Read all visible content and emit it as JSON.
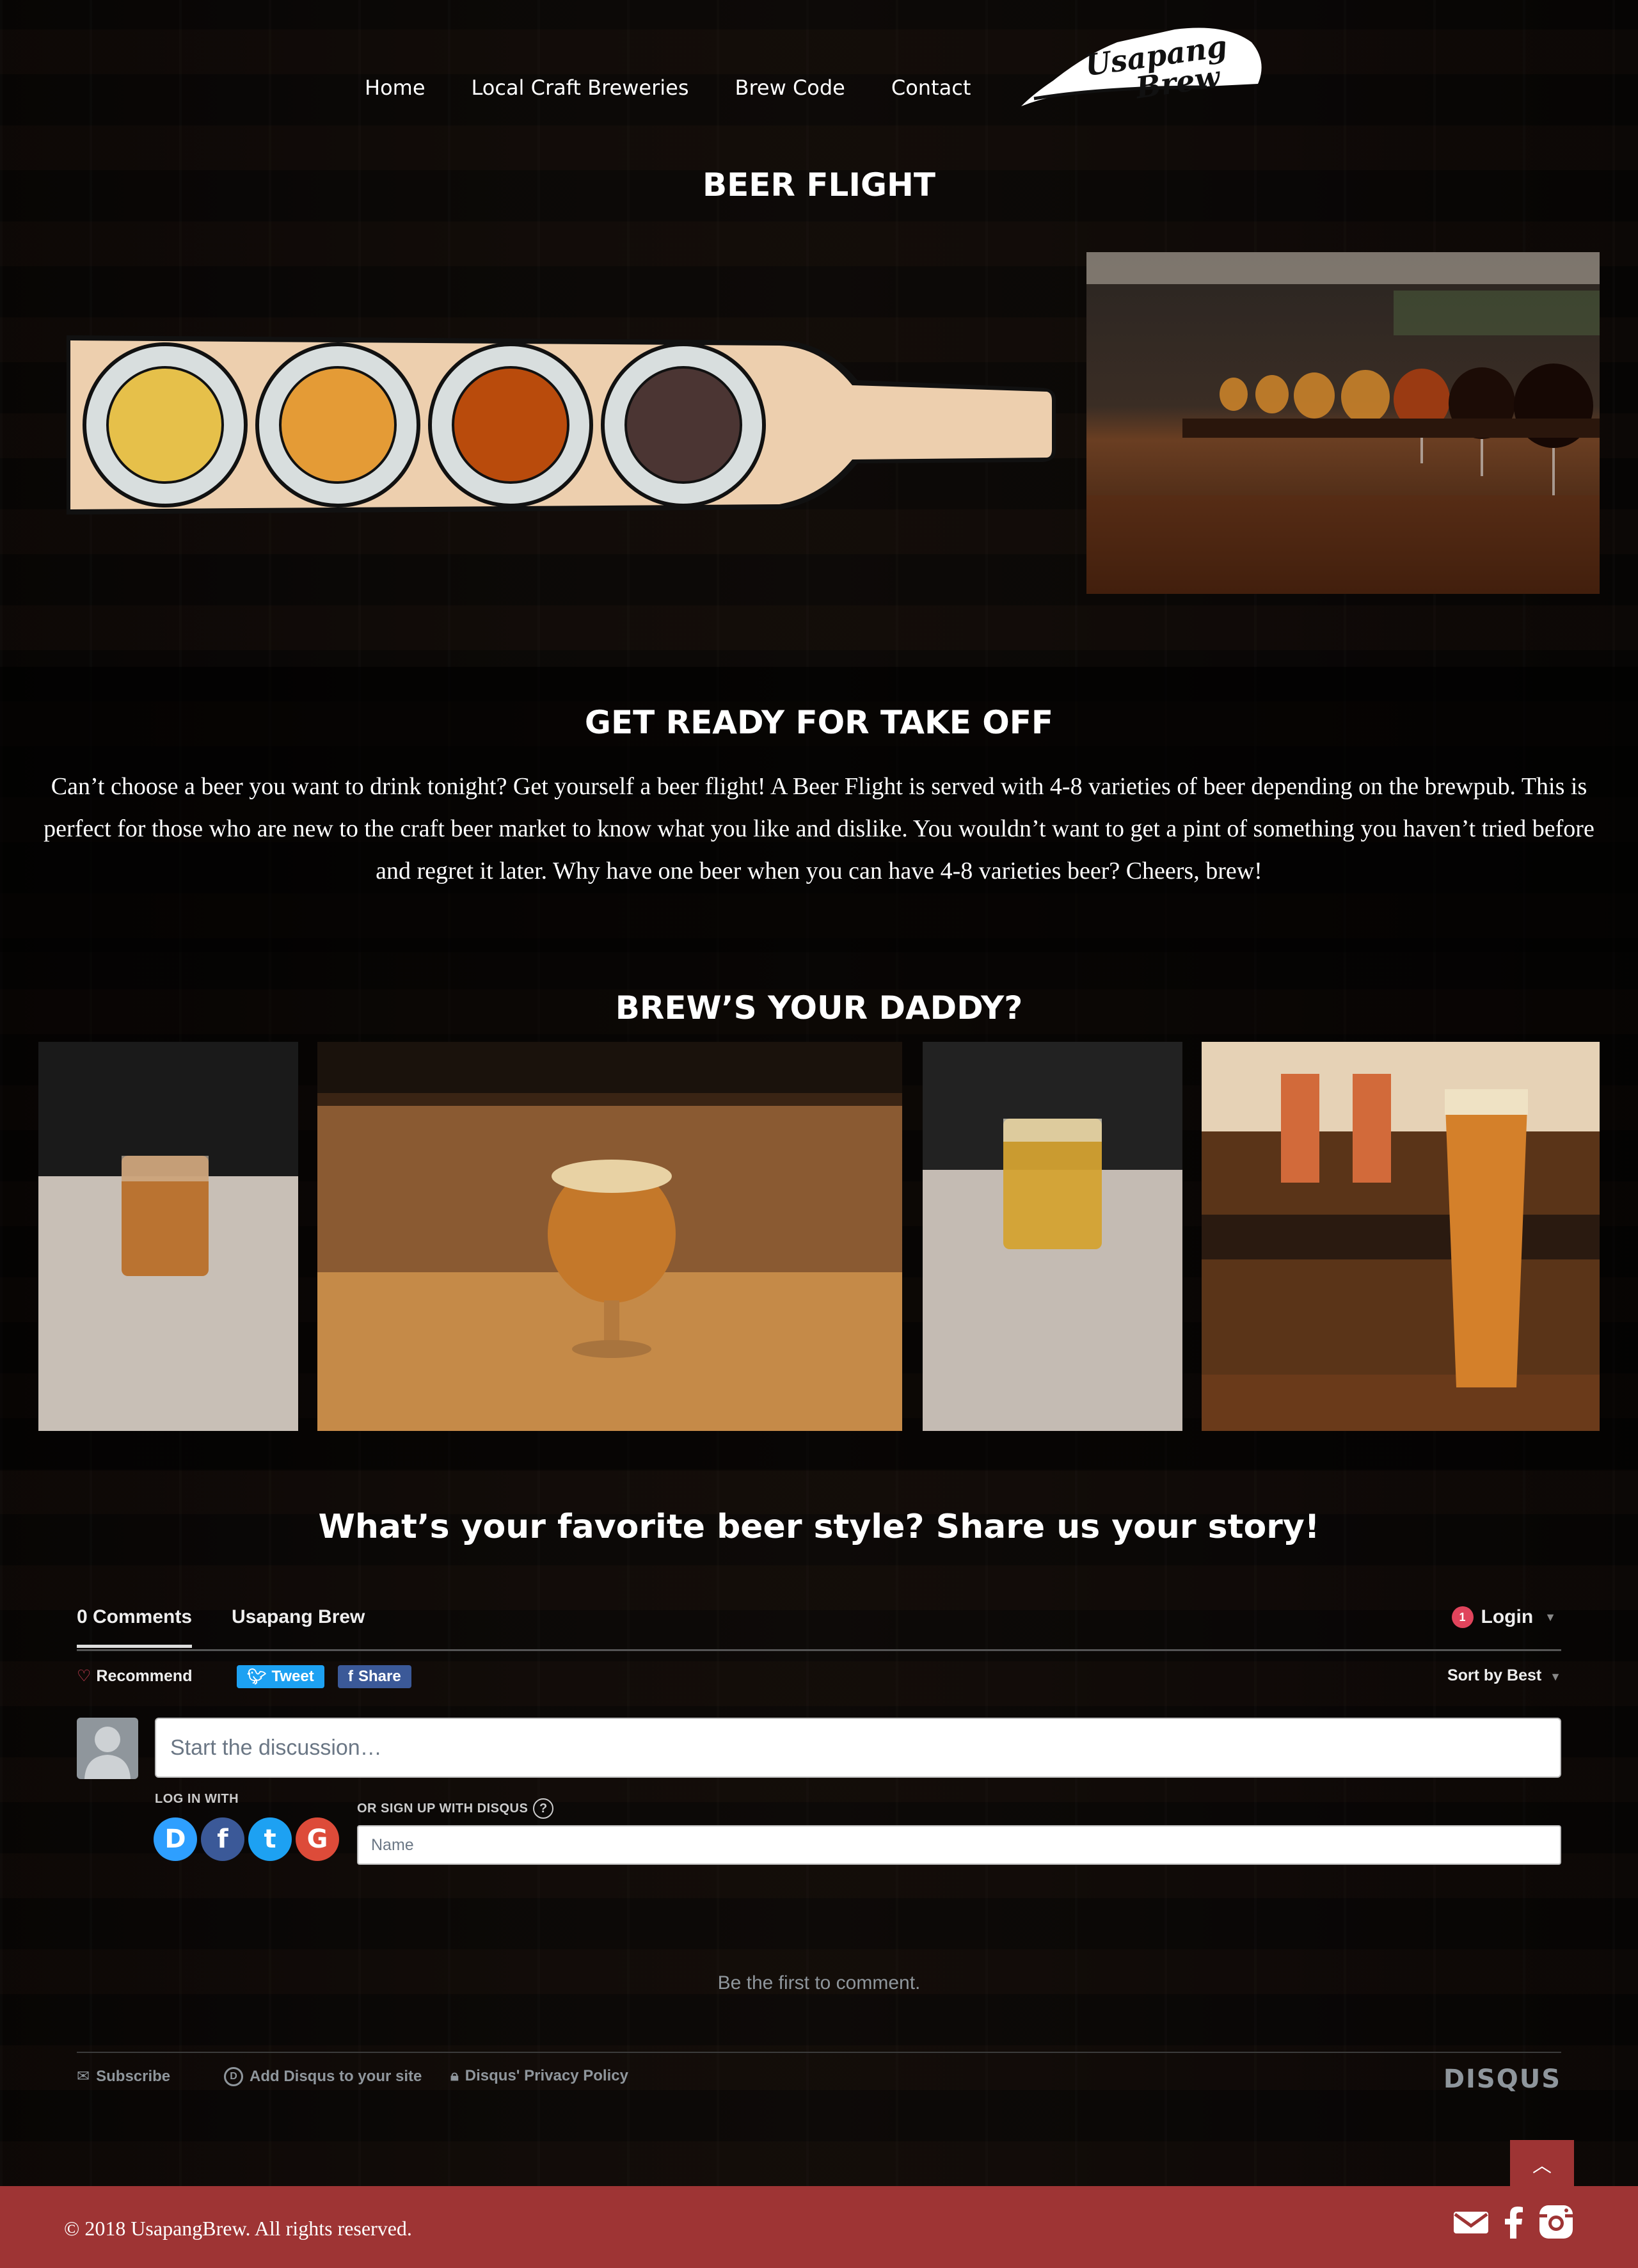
{
  "nav": {
    "items": [
      {
        "label": "Home"
      },
      {
        "label": "Local Craft Breweries"
      },
      {
        "label": "Brew Code"
      },
      {
        "label": "Contact"
      }
    ],
    "logo_text_line1": "Usapang",
    "logo_text_line2": "Brew"
  },
  "flight_section": {
    "title": "BEER FLIGHT",
    "beer_colors": [
      "#e6c04a",
      "#e49b36",
      "#b94b0c",
      "#4b3533"
    ]
  },
  "takeoff_section": {
    "title": "GET READY FOR TAKE OFF",
    "paragraph": "Can’t choose a beer you want to drink tonight? Get yourself a beer flight! A Beer Flight is served with 4-8 varieties of beer depending on the brewpub. This is perfect for those who are new to the craft beer market to know what you like and dislike. You wouldn’t want to get a pint of something you haven’t tried before and regret it later. Why have one beer when you can have 4-8 varieties beer? Cheers, brew!"
  },
  "gallery_section": {
    "title": "BREW’S YOUR DADDY?"
  },
  "comments_section": {
    "title": "What’s your favorite beer style? Share us your story!",
    "disqus": {
      "tab_comments": "0 Comments",
      "tab_site": "Usapang Brew",
      "login_label": "Login",
      "login_badge": "1",
      "recommend_label": "Recommend",
      "tweet_label": "Tweet",
      "share_label": "Share",
      "sort_label": "Sort by Best",
      "comment_placeholder": "Start the discussion…",
      "login_with_label": "LOG IN WITH",
      "signup_label": "OR SIGN UP WITH DISQUS",
      "name_placeholder": "Name",
      "first_comment_text": "Be the first to comment.",
      "footer_subscribe": "Subscribe",
      "footer_add": "Add Disqus to your site",
      "footer_privacy": "Disqus' Privacy Policy",
      "brand": "DISQUS",
      "social": [
        {
          "icon": "disqus-icon",
          "glyph": "D",
          "color": "#2e9fff"
        },
        {
          "icon": "facebook-icon",
          "glyph": "f",
          "color": "#3b5998"
        },
        {
          "icon": "twitter-icon",
          "glyph": "t",
          "color": "#1da1f2"
        },
        {
          "icon": "google-icon",
          "glyph": "G",
          "color": "#dd4b39"
        }
      ]
    }
  },
  "footer": {
    "copyright": "© 2018 UsapangBrew. All rights reserved.",
    "accent_color": "#9e3434"
  }
}
